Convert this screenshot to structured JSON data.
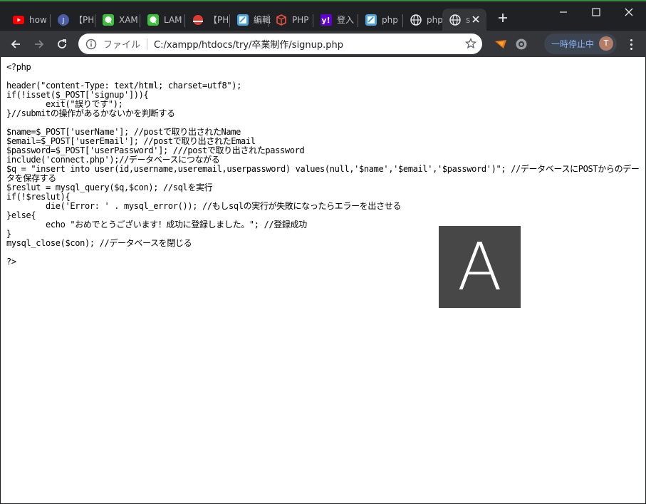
{
  "tabs": [
    {
      "label": "how",
      "icon": "youtube-icon",
      "color": "#ff0000"
    },
    {
      "label": "【PH",
      "icon": "j-logo-icon",
      "color": "#4a5fa8"
    },
    {
      "label": "XAM",
      "icon": "chat-bubble-icon",
      "color": "#3dbf3d"
    },
    {
      "label": "LAM",
      "icon": "chat-bubble-icon",
      "color": "#3dbf3d"
    },
    {
      "label": "【PH",
      "icon": "red-dot-icon",
      "color": "#e03a2f"
    },
    {
      "label": "編輯",
      "icon": "stackedit-icon",
      "color": "#4aa3df"
    },
    {
      "label": "PHP",
      "icon": "laravel-icon",
      "color": "#f05340"
    },
    {
      "label": "登入",
      "icon": "yahoo-icon",
      "color": "#6001d2"
    },
    {
      "label": "php",
      "icon": "stackedit-icon",
      "color": "#4aa3df"
    },
    {
      "label": "php",
      "icon": "globe-icon",
      "color": "#e8eaed"
    },
    {
      "label": "s",
      "icon": "globe-icon",
      "color": "#e8eaed",
      "active": true
    }
  ],
  "omnibox": {
    "scheme_label": "ファイル",
    "url": "C:/xampp/htdocs/try/卒業制作/signup.php"
  },
  "profile": {
    "paused_label": "一時停止中",
    "avatar_letter": "T"
  },
  "source_lines": [
    "<?php",
    "",
    "header(\"content-Type: text/html; charset=utf8\");",
    "if(!isset($_POST['signup'])){",
    "        exit(\"誤りです\");",
    "}//submitの操作があるかないかを判断する",
    "",
    "$name=$_POST['userName']; //postで取り出されたName",
    "$email=$_POST['userEmail']; //postで取り出されたEmail",
    "$password=$_POST['userPassword']; ///postで取り出されたpassword",
    "include('connect.php');//データベースにつながる",
    "$q = \"insert into user(id,username,useremail,userpassword) values(null,'$name','$email','$password')\"; //データベースにPOSTからのデータを保存する",
    "$reslut = mysql_query($q,$con); //sqlを実行",
    "if(!$reslut){",
    "        die('Error: ' . mysql_error()); //もしsqlの実行が失敗になったらエラーを出させる",
    "}else{",
    "        echo \"おめでとうございます！成功に登録しました。\"; //登録成功",
    "}",
    "mysql_close($con); //データベースを閉じる",
    "",
    "?>"
  ],
  "overlay_letter": "A"
}
